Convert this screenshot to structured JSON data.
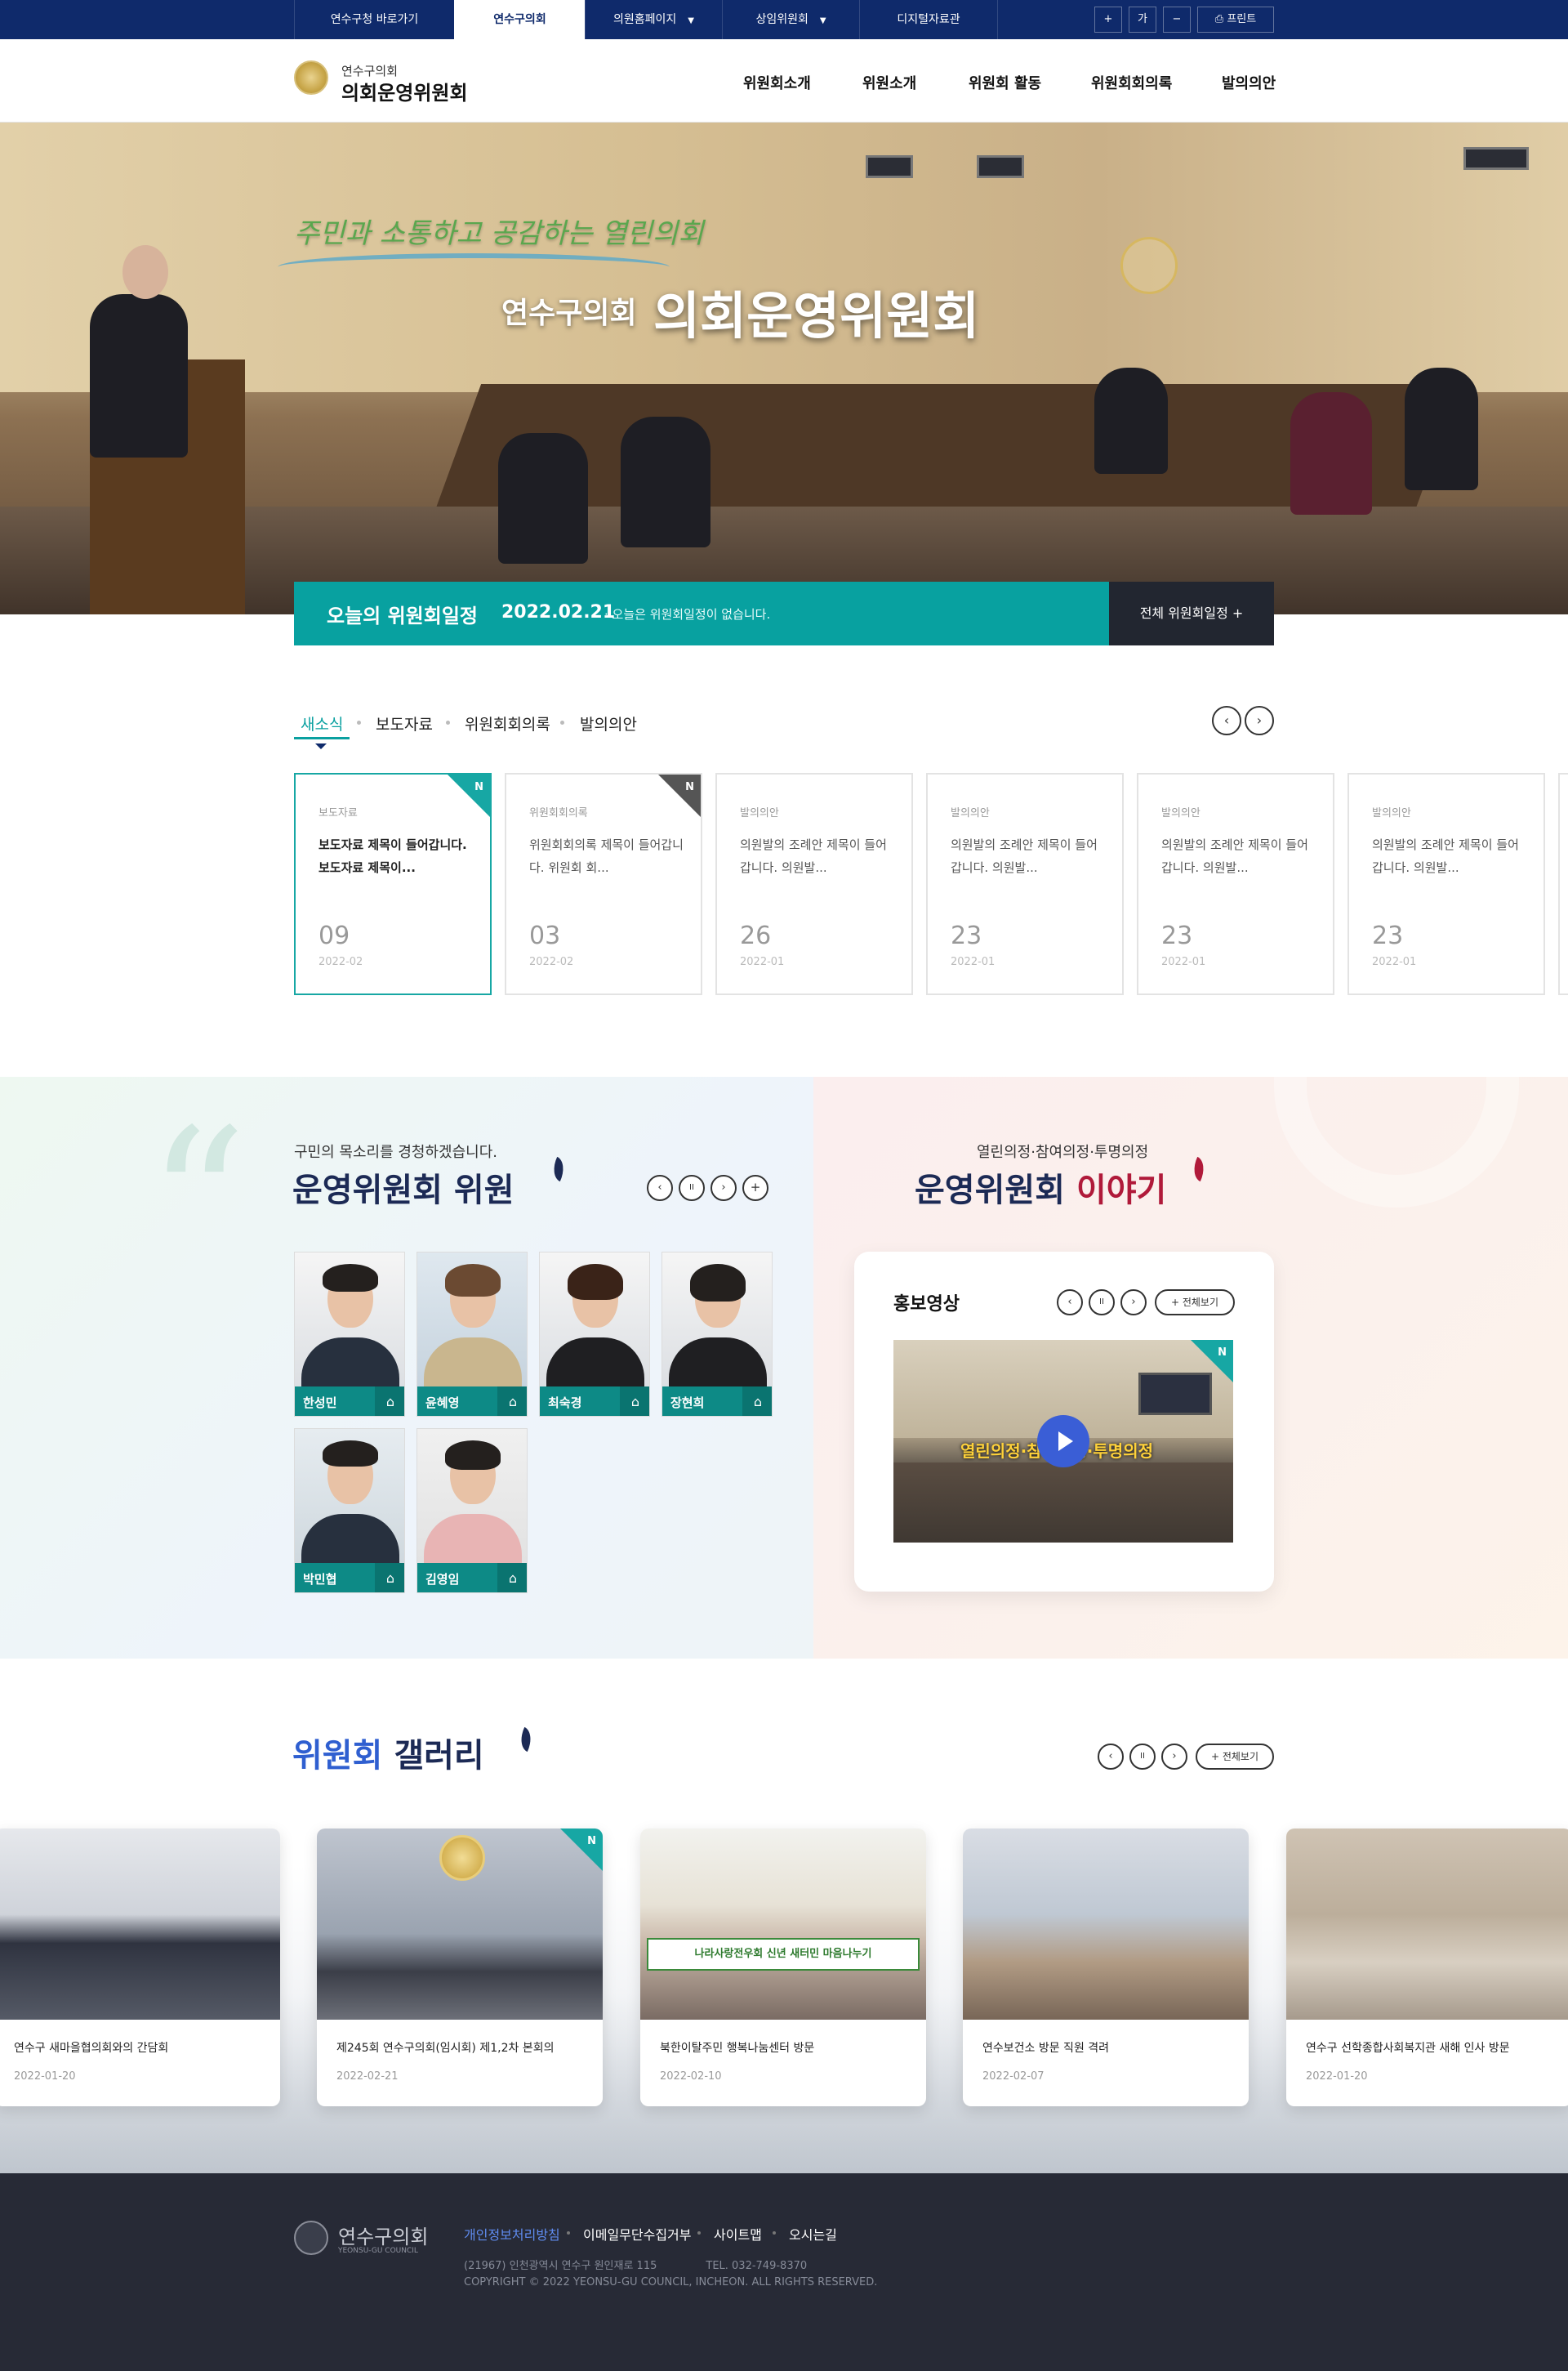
{
  "topbar": {
    "tabs": [
      "연수구청 바로가기",
      "연수구의회",
      "의원홈페이지",
      "상임위원회",
      "디지털자료관"
    ],
    "font_plus": "+",
    "font_label": "가",
    "font_minus": "−",
    "print": "프린트"
  },
  "header": {
    "logo_sub": "연수구의회",
    "logo_main": "의회운영위원회",
    "nav": [
      "위원회소개",
      "위원소개",
      "위원회 활동",
      "위원회회의록",
      "발의의안"
    ]
  },
  "hero": {
    "slogan": "주민과 소통하고 공감하는 열린의회",
    "sub": "연수구의회",
    "title": "의회운영위원회"
  },
  "schedule": {
    "label": "오늘의 위원회일정",
    "date": "2022.02.21",
    "message": "· 오늘은 위원회일정이 없습니다.",
    "all_button": "전체 위원회일정  +"
  },
  "news": {
    "tabs": [
      "새소식",
      "보도자료",
      "위원회회의록",
      "발의의안"
    ],
    "prev": "‹",
    "next": "›",
    "cards": [
      {
        "category": "보도자료",
        "title": "보도자료 제목이 들어갑니다. 보도자료 제목이...",
        "day": "09",
        "ym": "2022-02",
        "new": "N"
      },
      {
        "category": "위원회회의록",
        "title": "위원회회의록 제목이 들어갑니다. 위원회 회...",
        "day": "03",
        "ym": "2022-02",
        "new": "N"
      },
      {
        "category": "발의의안",
        "title": "의원발의 조례안 제목이 들어갑니다. 의원발...",
        "day": "26",
        "ym": "2022-01"
      },
      {
        "category": "발의의안",
        "title": "의원발의 조례안 제목이 들어갑니다. 의원발...",
        "day": "23",
        "ym": "2022-01"
      },
      {
        "category": "발의의안",
        "title": "의원발의 조례안 제목이 들어갑니다. 의원발...",
        "day": "23",
        "ym": "2022-01"
      },
      {
        "category": "발의의안",
        "title": "의원발의 조례안 제목이 들어갑니다. 의원발...",
        "day": "23",
        "ym": "2022-01"
      }
    ]
  },
  "members": {
    "subtitle": "구민의 목소리를 경청하겠습니다.",
    "title": "운영위원회 위원",
    "controls": [
      "‹",
      "II",
      "›",
      "+"
    ],
    "list": [
      "한성민",
      "윤혜영",
      "최숙경",
      "장현희",
      "박민협",
      "김영임"
    ],
    "home_icon": "⌂"
  },
  "story": {
    "subtitle": "열린의정·참여의정·투명의정",
    "title_a": "운영위원회 ",
    "title_b": "이야기",
    "video_title": "홍보영상",
    "controls": [
      "‹",
      "II",
      "›"
    ],
    "view_all": "+ 전체보기",
    "video_caption": "열린의정·참여의정·투명의정",
    "new": "N"
  },
  "gallery": {
    "title_a": "위원회 ",
    "title_b": "갤러리",
    "controls": [
      "‹",
      "II",
      "›"
    ],
    "view_all": "+ 전체보기",
    "new": "N",
    "items": [
      {
        "title": "연수구 새마을협의회와의 간담회",
        "date": "2022-01-20"
      },
      {
        "title": "제245회 연수구의회(임시회) 제1,2차 본회의",
        "date": "2022-02-21"
      },
      {
        "title": "북한이탈주민 행복나눔센터 방문",
        "date": "2022-02-10"
      },
      {
        "title": "연수보건소 방문 직원 격려",
        "date": "2022-02-07"
      },
      {
        "title": "연수구 선학종합사회복지관 새해 인사 방문",
        "date": "2022-01-20"
      }
    ],
    "banner_text": "나라사랑전우회 신년 새터민 마음나누기"
  },
  "footer": {
    "logo": "연수구의회",
    "logo_en": "YEONSU-GU COUNCIL",
    "links": [
      "개인정보처리방침",
      "이메일무단수집거부",
      "사이트맵",
      "오시는길"
    ],
    "address": "(21967) 인천광역시 연수구 원인재로 115",
    "tel": "TEL. 032-749-8370",
    "copyright": "COPYRIGHT © 2022 YEONSU-GU COUNCIL, INCHEON. ALL RIGHTS RESERVED."
  },
  "colors": {
    "navy": "#0f2a6b",
    "teal": "#08a1a0",
    "dark": "#222630",
    "crimson": "#b01a3a",
    "footer": "#272a36"
  }
}
